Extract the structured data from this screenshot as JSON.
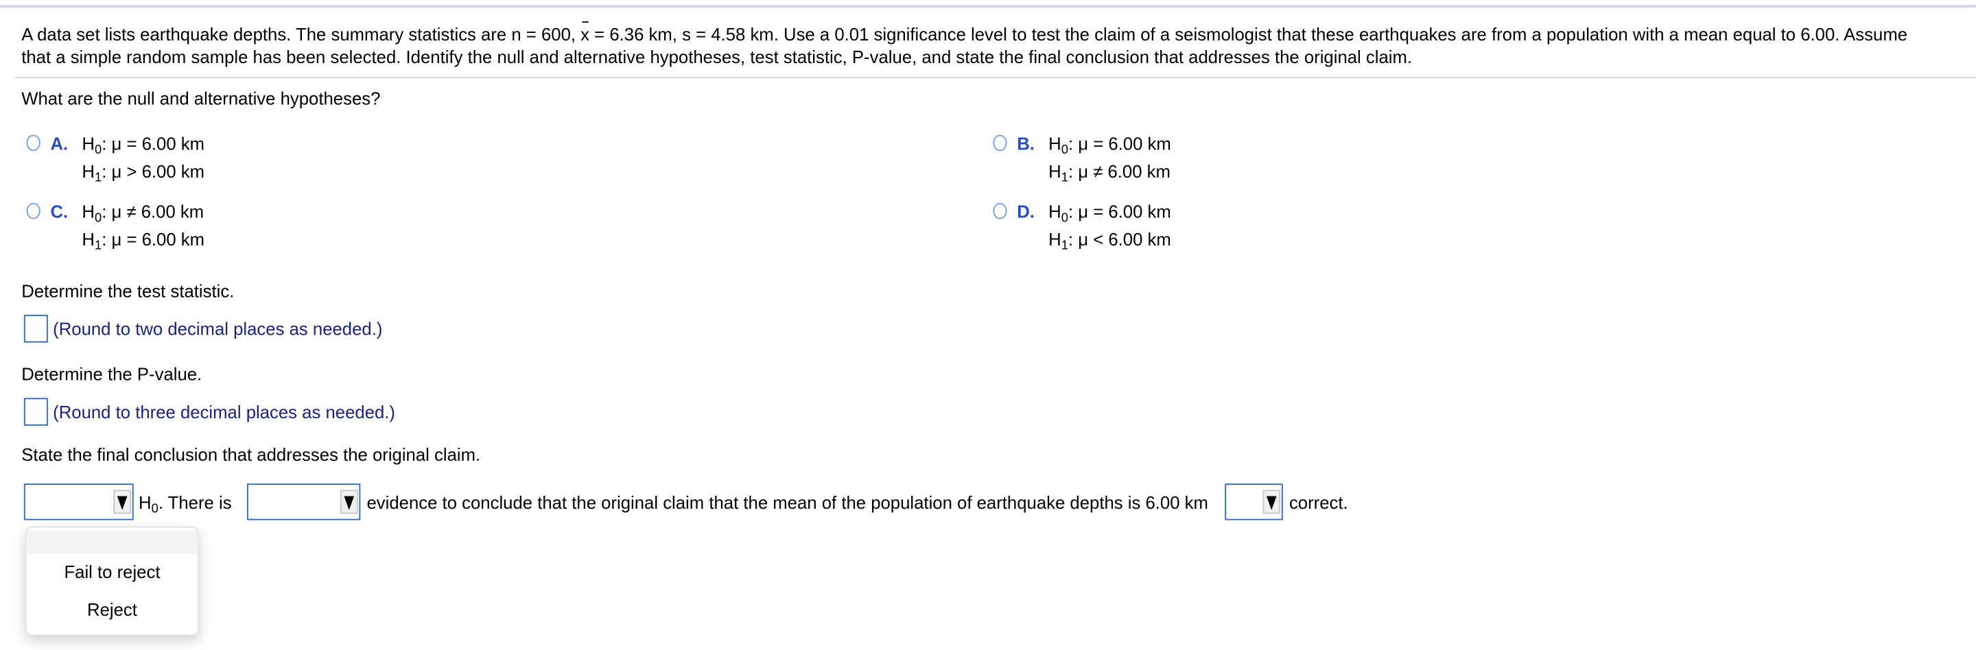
{
  "question": {
    "line1_pre": "A data set lists earthquake depths. The summary statistics are n = 600, ",
    "xbar": "x",
    "line1_post": " = 6.36 km, s = 4.58 km. Use a 0.01 significance level to test the claim of a seismologist that these earthquakes are from a population with a mean equal to 6.00. Assume",
    "line2": "that a simple random sample has been selected. Identify the null and alternative hypotheses, test statistic, P-value, and state the final conclusion that addresses the original claim."
  },
  "part1": {
    "prompt": "What are the null and alternative hypotheses?",
    "options": [
      {
        "label": "A.",
        "h0": "μ = 6.00 km",
        "h1": "μ > 6.00 km"
      },
      {
        "label": "B.",
        "h0": "μ = 6.00 km",
        "h1": "μ ≠ 6.00 km"
      },
      {
        "label": "C.",
        "h0": "μ ≠ 6.00 km",
        "h1": "μ = 6.00 km"
      },
      {
        "label": "D.",
        "h0": "μ = 6.00 km",
        "h1": "μ < 6.00 km"
      }
    ]
  },
  "part2": {
    "prompt": "Determine the test statistic.",
    "hint": "(Round to two decimal places as needed.)",
    "value": ""
  },
  "part3": {
    "prompt": "Determine the P-value.",
    "hint": "(Round to three decimal places as needed.)",
    "value": ""
  },
  "part4": {
    "prompt": "State the final conclusion that addresses the original claim.",
    "h0_text": "H",
    "text1": ". There is",
    "text2": "evidence to conclude that the original claim that the mean of the population of earthquake depths is 6.00 km",
    "text3": "correct.",
    "dropdown_options": [
      "Fail to reject",
      "Reject"
    ]
  },
  "colors": {
    "accent": "#2f67d0",
    "option_label": "#2b4cc0",
    "hint": "#1a237e"
  }
}
